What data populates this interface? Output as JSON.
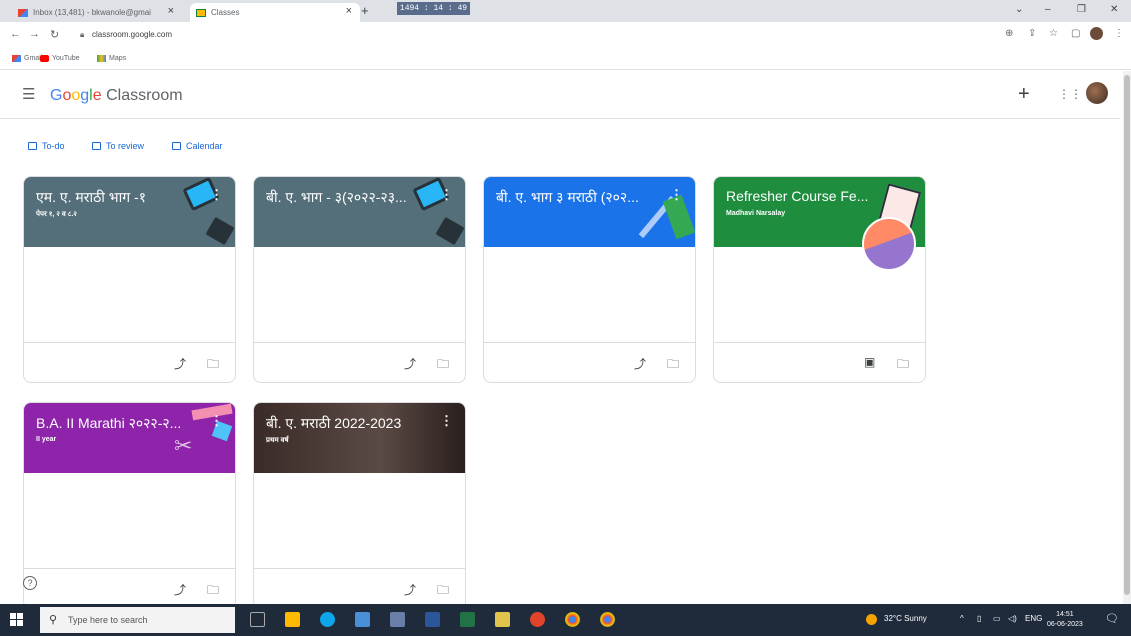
{
  "browser": {
    "tabs": [
      {
        "label": "Inbox (13,481) - bkwanole@gmai",
        "active": false
      },
      {
        "label": "Classes",
        "active": true
      }
    ],
    "new_tab": "+",
    "timer": "1494 : 14 : 49",
    "url": "classroom.google.com",
    "bookmarks": [
      "Gmail",
      "YouTube",
      "Maps"
    ]
  },
  "app": {
    "logo_google": [
      "G",
      "o",
      "o",
      "g",
      "l",
      "e"
    ],
    "logo_product": "Classroom"
  },
  "subnav": [
    "To-do",
    "To review",
    "Calendar"
  ],
  "cards": [
    {
      "title": "एम. ए. मराठी भाग -१",
      "subtitle": "पेपर १, २ व ८.२",
      "color": "#546e7a"
    },
    {
      "title": "बी. ए. भाग - ३(२०२२-२३...",
      "subtitle": "",
      "color": "#546e7a"
    },
    {
      "title": "बी. ए. भाग ३ मराठी (२०२...",
      "subtitle": "",
      "color": "#1a73e8"
    },
    {
      "title": "Refresher Course Fe...",
      "subtitle": "Madhavi Narsalay",
      "color": "#1e8e3e"
    },
    {
      "title": "B.A. II Marathi २०२२-२...",
      "subtitle": "II year",
      "color": "#8e24aa"
    },
    {
      "title": "बी. ए. मराठी 2022-2023",
      "subtitle": "प्रथम वर्ष",
      "color": "#3a2b28"
    }
  ],
  "help": "?",
  "taskbar": {
    "search_placeholder": "Type here to search",
    "weather": "32°C  Sunny",
    "lang": "ENG",
    "time": "14:51",
    "date": "06-06-2023"
  }
}
